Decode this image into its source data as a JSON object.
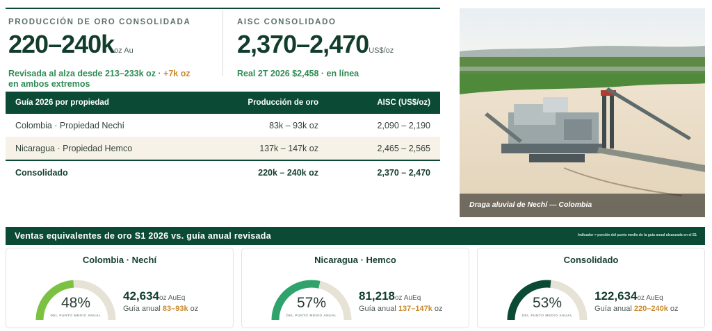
{
  "kpis": {
    "production": {
      "label": "PRODUCCIÓN DE ORO CONSOLIDADA",
      "value": "220–240k",
      "unit": "oz Au",
      "note_a": "Revisada al alza desde 213–233k oz · ",
      "note_accent": "+7k oz",
      "note_b": "en ambos extremos"
    },
    "aisc": {
      "label": "AISC CONSOLIDADO",
      "value": "2,370–2,470",
      "unit": "US$/oz",
      "note": "Real 2T 2026 $2,458 · en línea"
    }
  },
  "table": {
    "headers": [
      "Guía 2026 por propiedad",
      "Producción de oro",
      "AISC (US$/oz)"
    ],
    "rows": [
      {
        "name": "Colombia · Propiedad Nechí",
        "production": "83k – 93k oz",
        "aisc": "2,090 – 2,190"
      },
      {
        "name": "Nicaragua · Propiedad Hemco",
        "production": "137k – 147k oz",
        "aisc": "2,465 – 2,565"
      }
    ],
    "total": {
      "name": "Consolidado",
      "production": "220k – 240k oz",
      "aisc": "2,370 – 2,470"
    }
  },
  "photo": {
    "caption": "Draga aluvial de Nechí — Colombia"
  },
  "sales": {
    "title": "Ventas equivalentes de oro S1 2026 vs. guía anual revisada",
    "legend": "Indicador = porción del punto medio de la guía anual alcanzada en el S1",
    "cards": [
      {
        "name": "Colombia · Nechí",
        "pct": 48,
        "pct_label": "48%",
        "sub": "DEL PUNTO MEDIO ANUAL",
        "value": "42,634",
        "unit": "oz AuEq",
        "guide_label": "Guía anual ",
        "guide_value": "83–93k",
        "guide_unit": " oz",
        "color": "#7cc242"
      },
      {
        "name": "Nicaragua · Hemco",
        "pct": 57,
        "pct_label": "57%",
        "sub": "DEL PUNTO MEDIO ANUAL",
        "value": "81,218",
        "unit": "oz AuEq",
        "guide_label": "Guía anual ",
        "guide_value": "137–147k",
        "guide_unit": " oz",
        "color": "#2fa36b"
      },
      {
        "name": "Consolidado",
        "pct": 53,
        "pct_label": "53%",
        "sub": "DEL PUNTO MEDIO ANUAL",
        "value": "122,634",
        "unit": "oz AuEq",
        "guide_label": "Guía anual ",
        "guide_value": "220–240k",
        "guide_unit": " oz",
        "color": "#0b4a35"
      }
    ]
  },
  "colors": {
    "brand": "#0b4a35",
    "accent_green": "#2f8b55",
    "accent_gold": "#c98a2c",
    "gauge_track": "#e6e2d6"
  }
}
